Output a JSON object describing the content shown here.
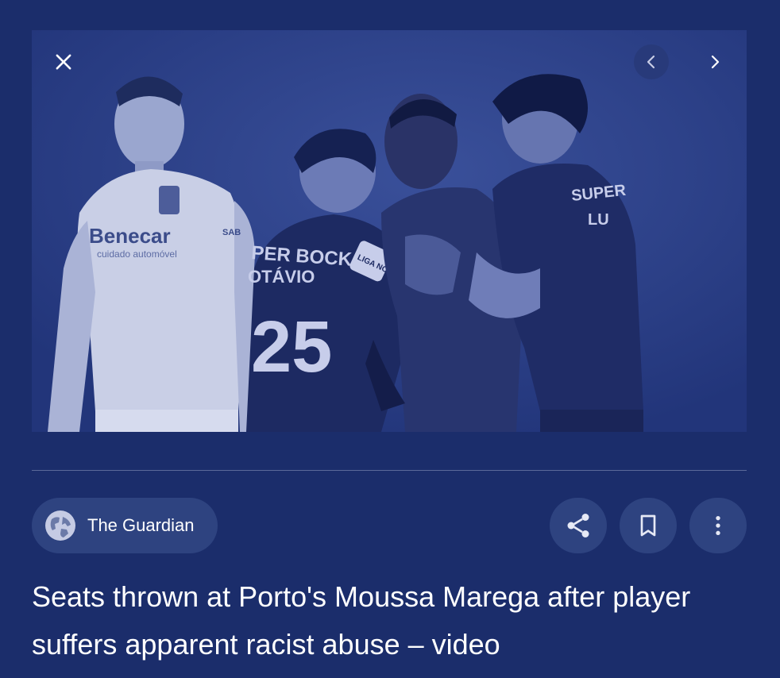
{
  "viewer": {
    "close_icon": "close-icon",
    "prev_icon": "chevron-left-icon",
    "next_icon": "chevron-right-icon",
    "image_alt": "Seats thrown at Porto's Moussa Marega after player suffers apparent racist abuse – video",
    "shirt_text": {
      "sponsor": "Benecar",
      "sponsor_sub": "cuidado automóvel",
      "sleeve": "SAB",
      "back_sponsor": "PER BOCK",
      "player_name": "OTÁVIO",
      "player_number": "25",
      "right_back_sponsor": "SUPER",
      "right_player_name": "LU",
      "patch": "LIGA NOS"
    }
  },
  "source": {
    "name": "The Guardian",
    "icon": "globe-icon"
  },
  "actions": {
    "share_icon": "share-icon",
    "save_icon": "bookmark-icon",
    "more_icon": "more-vertical-icon"
  },
  "article": {
    "headline": "Seats thrown at Porto's Moussa Marega after player suffers apparent racist abuse – video"
  },
  "colors": {
    "background": "#1b2d6b",
    "chip": "#2e4380",
    "divider": "#5b6a99",
    "text": "#ffffff"
  }
}
